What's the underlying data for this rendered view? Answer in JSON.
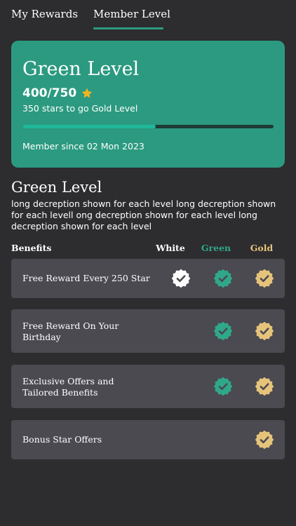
{
  "tabs": [
    {
      "label": "My Rewards",
      "active": false
    },
    {
      "label": "Member Level",
      "active": true
    }
  ],
  "level_card": {
    "title": "Green Level",
    "points": "400/750",
    "stars_to_go": "350 stars to go Gold Level",
    "progress_percent": 53,
    "member_since": "Member since 02 Mon 2023",
    "background_color": "#2b9a80",
    "star_icon": "star-icon"
  },
  "section": {
    "title": "Green Level",
    "description": "long decreption shown for each level long decreption shown for each levell ong decreption shown for each level long decreption shown for each level"
  },
  "benefits_header": {
    "label": "Benefits",
    "columns": [
      {
        "label": "White",
        "color": "#ffffff"
      },
      {
        "label": "Green",
        "color": "#2fa889"
      },
      {
        "label": "Gold",
        "color": "#e5c37a"
      }
    ]
  },
  "benefits": [
    {
      "label": "Free Reward Every 250 Star",
      "white": true,
      "green": true,
      "gold": true
    },
    {
      "label": "Free Reward On Your Birthday",
      "white": false,
      "green": true,
      "gold": true
    },
    {
      "label": "Exclusive Offers and Tailored Benefits",
      "white": false,
      "green": true,
      "gold": true
    },
    {
      "label": "Bonus Star Offers",
      "white": false,
      "green": false,
      "gold": true
    }
  ],
  "badge_colors": {
    "white": "#ffffff",
    "green": "#2fa889",
    "gold": "#e5c37a",
    "check": "#4b4a51"
  }
}
